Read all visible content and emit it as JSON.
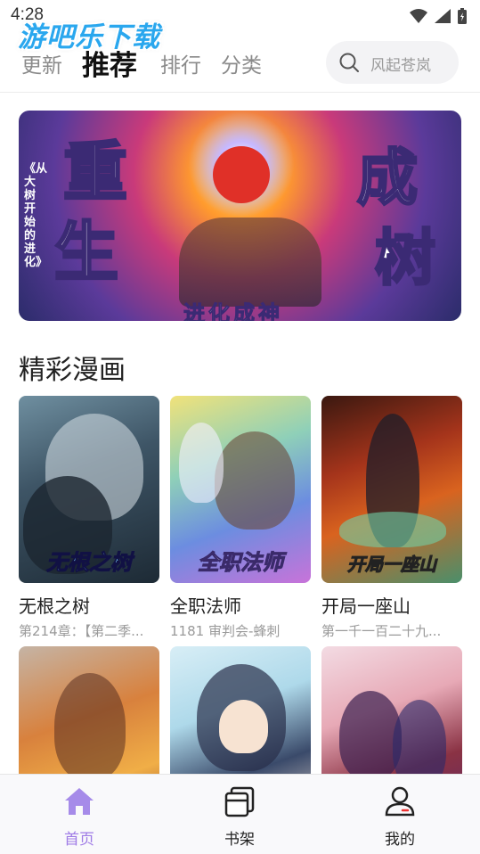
{
  "status_bar": {
    "time": "4:28"
  },
  "watermark": {
    "text": "游吧乐下载",
    "sub": ""
  },
  "top_nav": {
    "tabs": [
      {
        "label": "更新",
        "active": false
      },
      {
        "label": "推荐",
        "active": true
      },
      {
        "label": "排行",
        "active": false
      },
      {
        "label": "分类",
        "active": false
      }
    ],
    "search_placeholder": "风起苍岚"
  },
  "banner": {
    "title_chars": [
      "重",
      "生",
      "成",
      "树"
    ],
    "side_text": "《从大树开始的进化》",
    "bottom_text": "进化成神"
  },
  "section": {
    "title": "精彩漫画"
  },
  "comics": [
    {
      "title": "无根之树",
      "subtitle": "第214章：【第二季...",
      "logo": "无根之树"
    },
    {
      "title": "全职法师",
      "subtitle": "1181 审判会-蜂刺",
      "logo": "全职法师"
    },
    {
      "title": "开局一座山",
      "subtitle": "第一千一百二十九...",
      "logo": "开局一座山"
    },
    {
      "title": "",
      "subtitle": "",
      "logo": ""
    },
    {
      "title": "",
      "subtitle": "",
      "logo": ""
    },
    {
      "title": "",
      "subtitle": "",
      "logo": ""
    }
  ],
  "bottom_nav": [
    {
      "label": "首页",
      "icon": "home-icon",
      "active": true
    },
    {
      "label": "书架",
      "icon": "bookshelf-icon",
      "active": false
    },
    {
      "label": "我的",
      "icon": "profile-icon",
      "active": false
    }
  ],
  "colors": {
    "accent": "#9f7be6",
    "watermark": "#2aa7ee"
  }
}
